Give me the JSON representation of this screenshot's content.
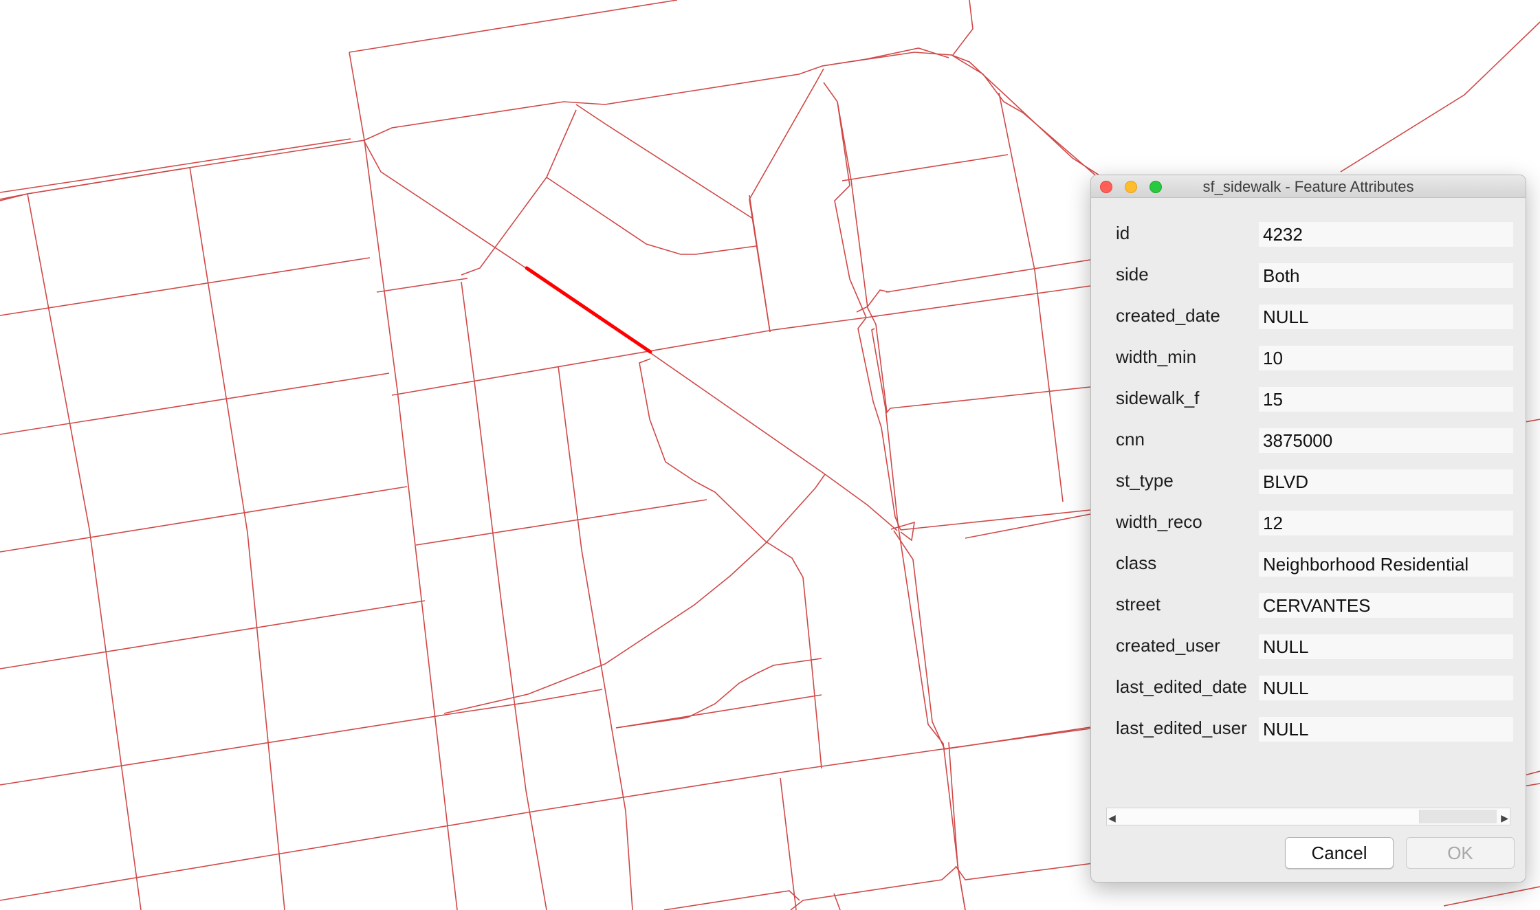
{
  "colors": {
    "sidewalk_line": "#d04848",
    "selected_line": "#ff0000",
    "dialog_bg": "#ececec"
  },
  "dialog": {
    "title": "sf_sidewalk - Feature Attributes",
    "fields": [
      {
        "label": "id",
        "value": "4232"
      },
      {
        "label": "side",
        "value": "Both"
      },
      {
        "label": "created_date",
        "value": "NULL"
      },
      {
        "label": "width_min",
        "value": "10"
      },
      {
        "label": "sidewalk_f",
        "value": "15"
      },
      {
        "label": "cnn",
        "value": "3875000"
      },
      {
        "label": "st_type",
        "value": "BLVD"
      },
      {
        "label": "width_reco",
        "value": "12"
      },
      {
        "label": "class",
        "value": "Neighborhood Residential"
      },
      {
        "label": "street",
        "value": "CERVANTES"
      },
      {
        "label": "created_user",
        "value": "NULL"
      },
      {
        "label": "last_edited_date",
        "value": "NULL"
      },
      {
        "label": "last_edited_user",
        "value": "NULL"
      }
    ],
    "buttons": {
      "cancel": "Cancel",
      "ok": "OK"
    },
    "icons": {
      "close": "close-icon",
      "minimize": "minimize-icon",
      "maximize": "maximize-icon",
      "scroll_left": "scroll-left-arrow-icon",
      "scroll_right": "scroll-right-arrow-icon"
    }
  }
}
